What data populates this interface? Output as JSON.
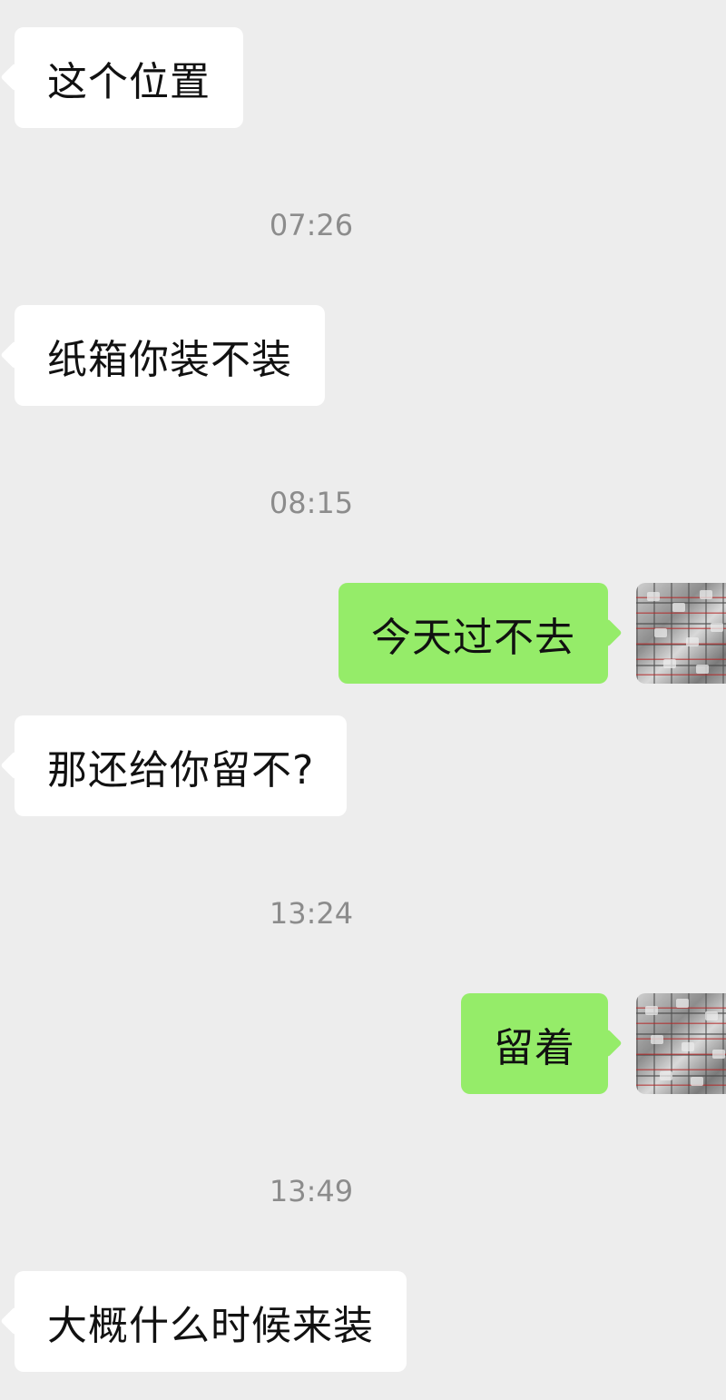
{
  "messages": [
    {
      "kind": "incoming",
      "text": "这个位置"
    },
    {
      "kind": "time",
      "text": "07:26"
    },
    {
      "kind": "incoming",
      "text": "纸箱你装不装"
    },
    {
      "kind": "time",
      "text": "08:15"
    },
    {
      "kind": "outgoing",
      "text": "今天过不去",
      "avatar": "user-avatar-photo"
    },
    {
      "kind": "incoming",
      "text": "那还给你留不?"
    },
    {
      "kind": "time",
      "text": "13:24"
    },
    {
      "kind": "outgoing",
      "text": "留着",
      "avatar": "user-avatar-photo"
    },
    {
      "kind": "time",
      "text": "13:49"
    },
    {
      "kind": "incoming",
      "text": "大概什么时候来装"
    }
  ],
  "colors": {
    "background": "#ededed",
    "incoming_bubble": "#ffffff",
    "outgoing_bubble": "#95ec69",
    "message_text": "#111111",
    "timestamp_text": "#8c8c8c"
  }
}
